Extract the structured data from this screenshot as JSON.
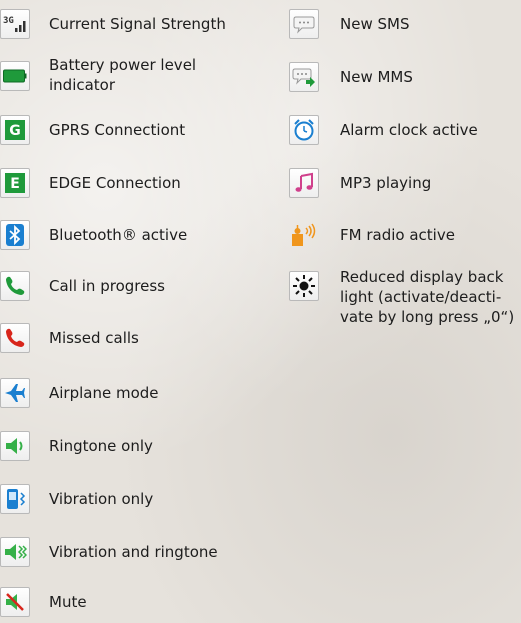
{
  "left_items": [
    {
      "label": "Current Signal Strength",
      "icon": "signal-strength-3g-icon"
    },
    {
      "label": "Battery power level indicator",
      "icon": "battery-icon"
    },
    {
      "label": "GPRS Connectiont",
      "icon": "gprs-icon",
      "glyph": "G"
    },
    {
      "label": "EDGE Connection",
      "icon": "edge-icon",
      "glyph": "E"
    },
    {
      "label": "Bluetooth® active",
      "icon": "bluetooth-icon"
    },
    {
      "label": "Call in progress",
      "icon": "phone-green-icon"
    },
    {
      "label": "Missed calls",
      "icon": "phone-red-icon"
    },
    {
      "label": "Airplane mode",
      "icon": "airplane-icon"
    },
    {
      "label": "Ringtone only",
      "icon": "speaker-icon"
    },
    {
      "label": "Vibration only",
      "icon": "vibration-icon"
    },
    {
      "label": "Vibration and ringtone",
      "icon": "speaker-vibration-icon"
    },
    {
      "label": "Mute",
      "icon": "mute-icon"
    }
  ],
  "right_items": [
    {
      "label": "New SMS",
      "icon": "sms-icon"
    },
    {
      "label": "New MMS",
      "icon": "mms-icon"
    },
    {
      "label": "Alarm clock active",
      "icon": "alarm-clock-icon"
    },
    {
      "label": "MP3 playing",
      "icon": "music-note-icon"
    },
    {
      "label": "FM radio active",
      "icon": "fm-radio-icon"
    },
    {
      "label": "Reduced display back light (activate/deacti- vate by long press „0“)",
      "icon": "backlight-sun-icon"
    }
  ],
  "colors": {
    "green": "#1f9a3b",
    "red": "#d8261c",
    "blue": "#1a7fd0",
    "orange": "#f0961c",
    "pink": "#d0408c"
  }
}
